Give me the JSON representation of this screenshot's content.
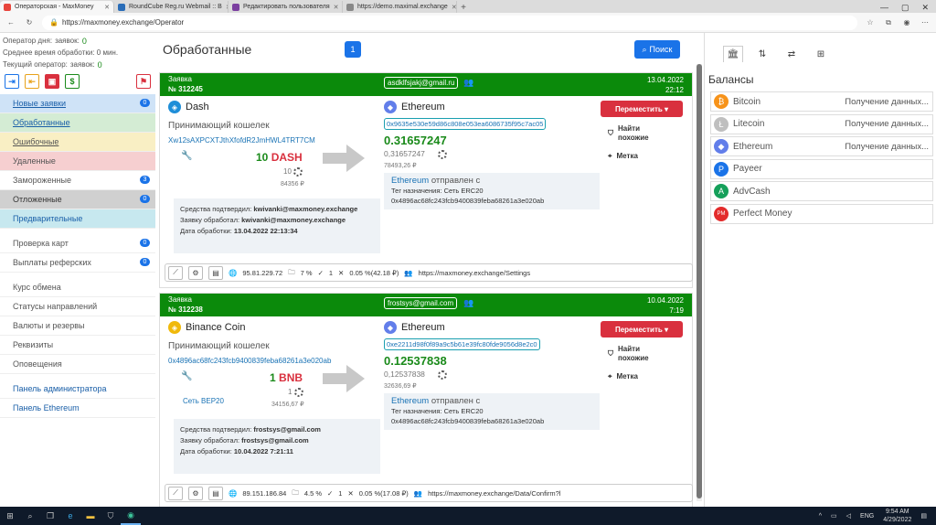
{
  "browser": {
    "tabs": [
      {
        "label": "Операторская - MaxMoney",
        "color": "#e8453c"
      },
      {
        "label": "RoundCube Reg.ru Webmail :: B",
        "color": "#2a6db8"
      },
      {
        "label": "Редактировать пользователя",
        "color": "#7b3fa0"
      },
      {
        "label": "https://demo.maximal.exchange",
        "color": "#888888"
      }
    ],
    "url": "https://maxmoney.exchange/Operator"
  },
  "sidebar": {
    "stats": [
      {
        "label": "Оператор дня:",
        "extra": "заявок:",
        "value": "0"
      },
      {
        "label": "Среднее время обработки: 0 мин.",
        "extra": "",
        "value": ""
      },
      {
        "label": "Текущий оператор:",
        "extra": "заявок:",
        "value": "0"
      }
    ],
    "menu": [
      {
        "label": "Новые заявки",
        "badge": "0",
        "bg": "#cfe3f7",
        "color": "#1a5fa8"
      },
      {
        "label": "Обработанные",
        "badge": "",
        "bg": "#d4ecd4",
        "color": "#1a5fa8"
      },
      {
        "label": "Ошибочные",
        "badge": "",
        "bg": "#f9efc4",
        "color": "#555"
      },
      {
        "label": "Удаленные",
        "badge": "",
        "bg": "#f6cfd0",
        "color": "#555"
      },
      {
        "label": "Замороженные",
        "badge": "3",
        "bg": "#fff",
        "color": "#555"
      },
      {
        "label": "Отложенные",
        "badge": "0",
        "bg": "#d0d0d0",
        "color": "#333"
      },
      {
        "label": "Предварительные",
        "badge": "",
        "bg": "#c7e8ef",
        "color": "#1a5fa8"
      }
    ],
    "menu2": [
      {
        "label": "Проверка карт",
        "badge": "0"
      },
      {
        "label": "Выплаты реферских",
        "badge": "0"
      }
    ],
    "menu3": [
      "Курс обмена",
      "Статусы направлений",
      "Валюты и резервы",
      "Реквизиты",
      "Оповещения"
    ],
    "menu4": [
      "Панель администратора",
      "Панель Ethereum"
    ]
  },
  "main": {
    "title": "Обработанные",
    "page": "1",
    "search_label": "Поиск"
  },
  "orders": [
    {
      "head_label": "Заявка",
      "number": "№ 312245",
      "email": "asdklfsjakj@gmail.ru",
      "date": "13.04.2022",
      "time": "22:12",
      "from_coin": "Dash",
      "from_icon_color": "#1e8ed8",
      "wallet_label": "Принимающий кошелек",
      "wallet": "Xw12sAXPCXTJthXfofdR2JmHWL4TRT7CM",
      "network": "",
      "amount": "10",
      "currency": "DASH",
      "amount_small": "10",
      "rub": "84356 ₽",
      "to_coin": "Ethereum",
      "hash": "0x9635e530e59d86c808e053ea6086735f95c7ac05",
      "to_amount": "0.31657247",
      "to_amount_small": "0,31657247",
      "to_rub": "78493,26 ₽",
      "confirm": [
        {
          "label": "Средства подтвердил:",
          "value": "kwivanki@maxmoney.exchange"
        },
        {
          "label": "Заявку обработал:",
          "value": "kwivanki@maxmoney.exchange"
        },
        {
          "label": "Дата обработки:",
          "value": "13.04.2022 22:13:34"
        }
      ],
      "sent_coin": "Ethereum",
      "sent_label": "отправлен с",
      "tag": "Тег назначения: Сеть ERC20",
      "sent_addr": "0x4896ac68fc243fcb9400839feba68261a3e020ab",
      "move": "Переместить",
      "find_similar": "Найти похожие",
      "mark": "Метка",
      "ip": "95.81.229.72",
      "pct": "7 %",
      "count": "1",
      "fee": "0.05 %(42.18 ₽)",
      "ref": "https://maxmoney.exchange/Settings"
    },
    {
      "head_label": "Заявка",
      "number": "№ 312238",
      "email": "frostsys@gmail.com",
      "date": "10.04.2022",
      "time": "7:19",
      "from_coin": "Binance Coin",
      "from_icon_color": "#f0b90b",
      "wallet_label": "Принимающий кошелек",
      "wallet": "0x4896ac68fc243fcb9400839feba68261a3e020ab",
      "network": "Сеть BEP20",
      "amount": "1",
      "currency": "BNB",
      "amount_small": "1",
      "rub": "34156,67 ₽",
      "to_coin": "Ethereum",
      "hash": "0xe2211d98f0f89a9c5b61e39fc80fde9056d8e2c0",
      "to_amount": "0.12537838",
      "to_amount_small": "0,12537838",
      "to_rub": "32636,69 ₽",
      "confirm": [
        {
          "label": "Средства подтвердил:",
          "value": "frostsys@gmail.com"
        },
        {
          "label": "Заявку обработал:",
          "value": "frostsys@gmail.com"
        },
        {
          "label": "Дата обработки:",
          "value": "10.04.2022 7:21:11"
        }
      ],
      "sent_coin": "Ethereum",
      "sent_label": "отправлен с",
      "tag": "Тег назначения: Сеть ERC20",
      "sent_addr": "0x4896ac68fc243fcb9400839feba68261a3e020ab",
      "move": "Переместить",
      "find_similar": "Найти похожие",
      "mark": "Метка",
      "ip": "89.151.186.84",
      "pct": "4.5 %",
      "count": "1",
      "fee": "0.05 %(17.08 ₽)",
      "ref": "https://maxmoney.exchange/Data/Confirm?l"
    }
  ],
  "balances": {
    "title": "Балансы",
    "items": [
      {
        "name": "Bitcoin",
        "value": "Получение данных...",
        "color": "#f7931a",
        "glyph": "₿"
      },
      {
        "name": "Litecoin",
        "value": "Получение данных...",
        "color": "#bfbfbf",
        "glyph": "Ł"
      },
      {
        "name": "Ethereum",
        "value": "Получение данных...",
        "color": "#627eea",
        "glyph": "◆"
      },
      {
        "name": "Payeer",
        "value": "",
        "color": "#1a73e8",
        "glyph": "P"
      },
      {
        "name": "AdvCash",
        "value": "",
        "color": "#15a05a",
        "glyph": "A"
      },
      {
        "name": "Perfect Money",
        "value": "",
        "color": "#e32b2b",
        "glyph": "PM"
      }
    ]
  },
  "taskbar": {
    "lang": "ENG",
    "time": "9:54 AM",
    "date": "4/29/2022"
  }
}
